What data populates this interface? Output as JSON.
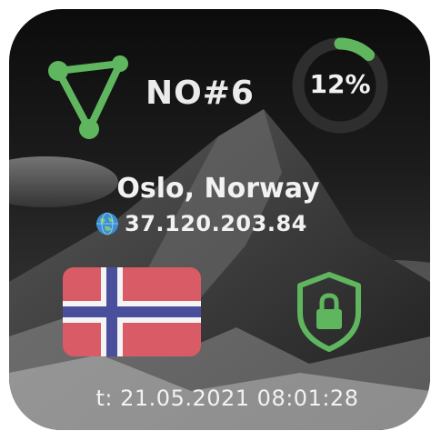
{
  "widget": {
    "server_name": "NO#6",
    "load_percent": 12,
    "load_label": "12%",
    "location": "Oslo, Norway",
    "ip_address": "37.120.203.84",
    "timestamp": "t: 21.05.2021 08:01:28",
    "vpn_status": "connected"
  },
  "icons": {
    "logo": "triangle-network-icon",
    "ip": "globe-icon",
    "flag": "norway-flag",
    "status": "shield-lock-icon"
  },
  "colors": {
    "accent": "#5fb65f",
    "gauge_track": "#2e2e2e",
    "flag_red": "#d95b66",
    "flag_blue": "#4a4f9c",
    "flag_white": "#f4f4f4"
  }
}
